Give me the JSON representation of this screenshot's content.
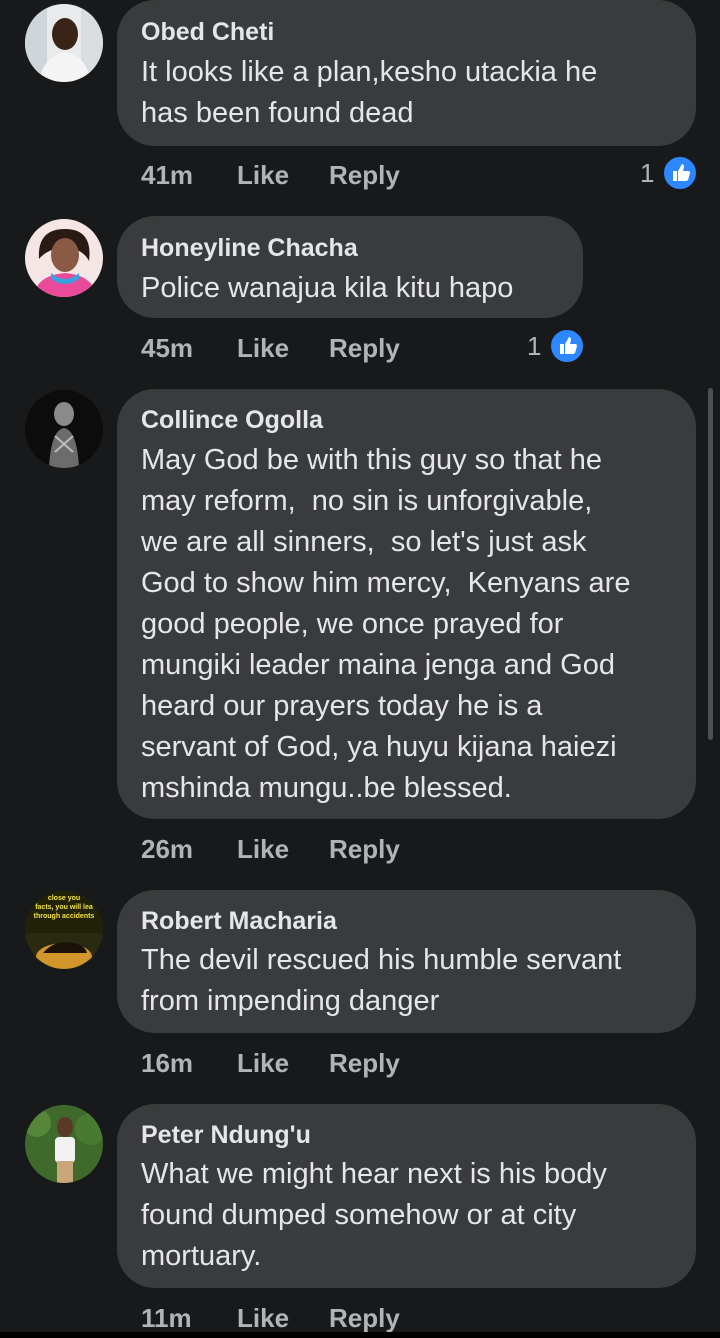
{
  "colors": {
    "background": "#18191a",
    "bubble": "#3a3b3c",
    "primary_text": "#e4e6eb",
    "secondary_text": "#b0b3b8",
    "like_blue": "#2d88ff"
  },
  "actions": {
    "like_label": "Like",
    "reply_label": "Reply"
  },
  "comments": [
    {
      "author": "Obed Cheti",
      "text": "It looks like a plan,kesho utackia he\nhas been found dead",
      "time": "41m",
      "reactions": "1",
      "reaction_icon": "like-icon"
    },
    {
      "author": "Honeyline Chacha",
      "text": "Police wanajua kila kitu hapo",
      "time": "45m",
      "reactions": "1",
      "reaction_icon": "like-icon"
    },
    {
      "author": "Collince Ogolla",
      "text": "May God be with this guy so that he\nmay reform,  no sin is unforgivable,\nwe are all sinners,  so let's just ask\nGod to show him mercy,  Kenyans are\ngood people, we once prayed for\nmungiki leader maina jenga and God\nheard our prayers today he is a\nservant of God, ya huyu kijana haiezi\nmshinda mungu..be blessed.",
      "time": "26m"
    },
    {
      "author": "Robert Macharia",
      "text": "The devil rescued his humble servant\nfrom impending danger",
      "time": "16m",
      "avatar_text": [
        "close you",
        "facts, you will lea",
        "through accidents"
      ]
    },
    {
      "author": "Peter Ndung'u",
      "text": "What we might hear next is his body\nfound dumped somehow or at city\nmortuary.",
      "time": "11m"
    }
  ]
}
